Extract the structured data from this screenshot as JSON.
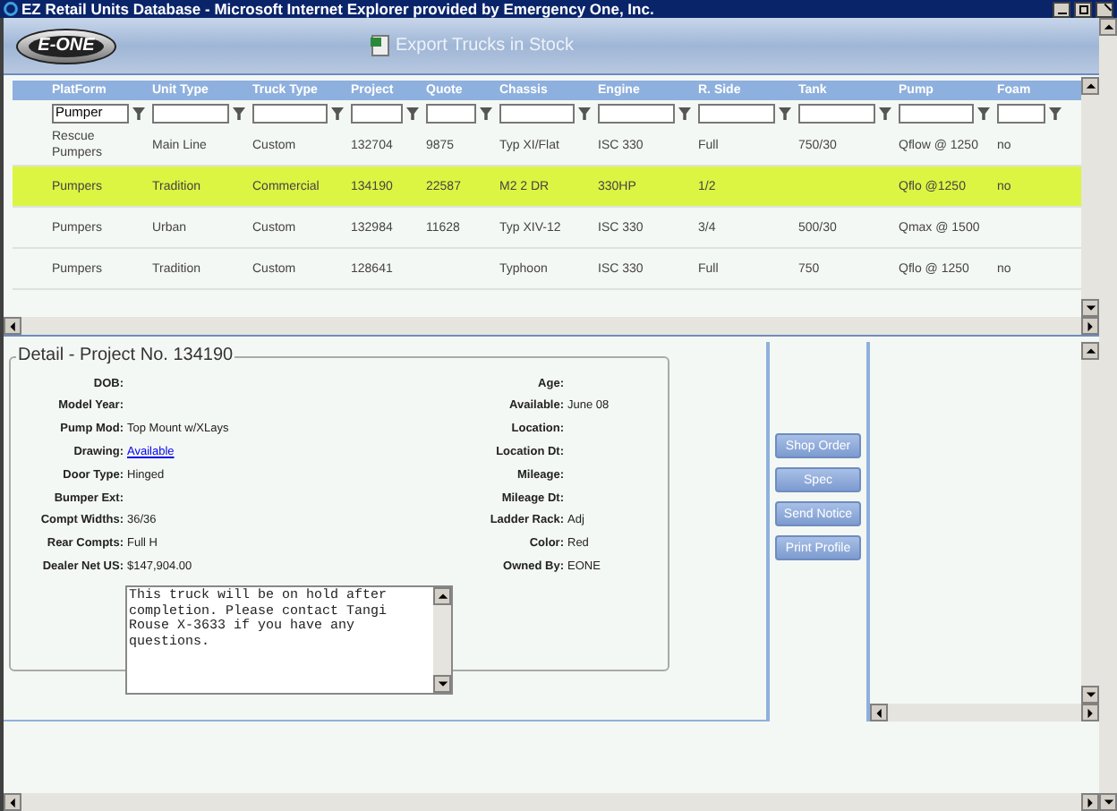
{
  "window": {
    "title": "EZ Retail Units Database - Microsoft Internet Explorer provided by Emergency One, Inc."
  },
  "header": {
    "logo": "E-ONE",
    "export_link": "Export Trucks in Stock"
  },
  "grid": {
    "columns": [
      {
        "label": "PlatForm",
        "filter": "Pumper"
      },
      {
        "label": "Unit Type"
      },
      {
        "label": "Truck Type"
      },
      {
        "label": "Project"
      },
      {
        "label": "Quote"
      },
      {
        "label": "Chassis"
      },
      {
        "label": "Engine"
      },
      {
        "label": "R. Side"
      },
      {
        "label": "Tank"
      },
      {
        "label": "Pump"
      },
      {
        "label": "Foam"
      }
    ],
    "rows": [
      {
        "selected": false,
        "cells": [
          "Rescue Pumpers",
          "Main Line",
          "Custom",
          "132704",
          "9875",
          "Typ XI/Flat",
          "ISC 330",
          "Full",
          "750/30",
          "Qflow @ 1250",
          "no"
        ]
      },
      {
        "selected": true,
        "cells": [
          "Pumpers",
          "Tradition",
          "Commercial",
          "134190",
          "22587",
          "M2 2 DR",
          "330HP",
          "1/2",
          null,
          "Qflo @1250",
          "no"
        ]
      },
      {
        "selected": false,
        "cells": [
          "Pumpers",
          "Urban",
          "Custom",
          "132984",
          "11628",
          "Typ XIV-12",
          "ISC 330",
          "3/4",
          "500/30",
          "Qmax @ 1500",
          null
        ]
      },
      {
        "selected": false,
        "cells": [
          "Pumpers",
          "Tradition",
          "Custom",
          "128641",
          null,
          "Typhoon",
          "ISC 330",
          "Full",
          "750",
          "Qflo @ 1250",
          "no"
        ]
      }
    ]
  },
  "detail": {
    "title": "Detail - Project No. 134190",
    "left_fields": [
      {
        "label": "DOB:"
      },
      {
        "label": "Model Year:"
      },
      {
        "label": "Pump Mod:",
        "value": "Top Mount w/XLays",
        "kind": "text"
      },
      {
        "label": "Drawing:",
        "value": "Available",
        "kind": "link"
      },
      {
        "label": "Door Type:",
        "value": "Hinged",
        "kind": "text"
      },
      {
        "label": "Bumper Ext:"
      },
      {
        "label": "Compt Widths:",
        "value": "36/36",
        "kind": "text"
      },
      {
        "label": "Rear Compts:",
        "value": "Full H",
        "kind": "text"
      },
      {
        "label": "Dealer Net US:",
        "value": "$147,904.00",
        "kind": "text"
      }
    ],
    "right_fields": [
      {
        "label": "Age:"
      },
      {
        "label": "Available:",
        "value": "June 08",
        "kind": "text"
      },
      {
        "label": "Location:"
      },
      {
        "label": "Location Dt:"
      },
      {
        "label": "Mileage:"
      },
      {
        "label": "Mileage Dt:"
      },
      {
        "label": "Ladder Rack:",
        "value": "Adj",
        "kind": "text"
      },
      {
        "label": "Color:",
        "value": "Red",
        "kind": "text"
      },
      {
        "label": "Owned By:",
        "value": "EONE",
        "kind": "text"
      }
    ],
    "notes": "This truck will be on hold after completion.  Please contact Tangi Rouse X-3633 if you have any questions.",
    "buttons": [
      "Shop Order",
      "Spec",
      "Send Notice",
      "Print Profile"
    ]
  }
}
